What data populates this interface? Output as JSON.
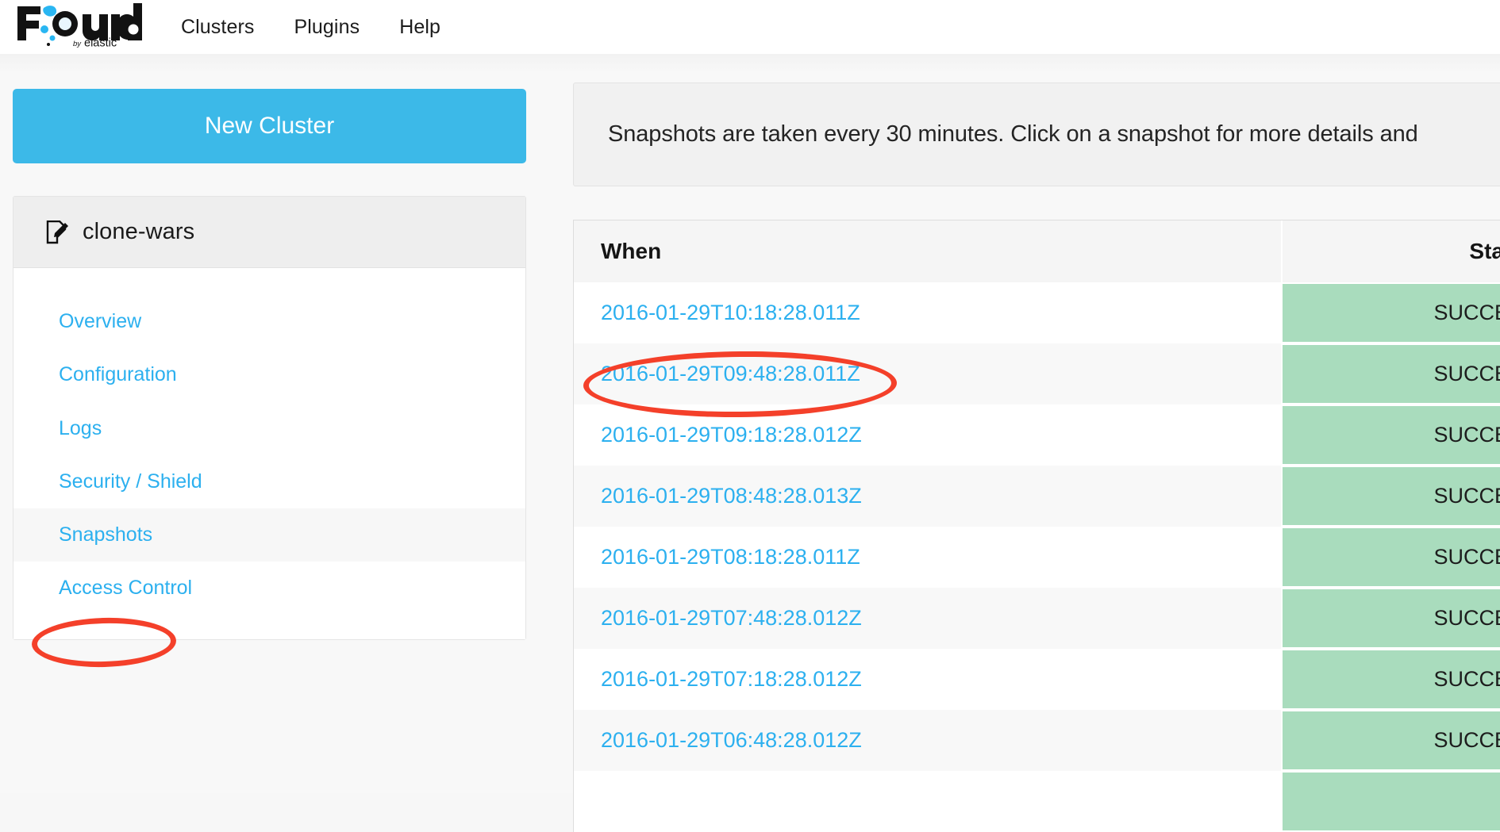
{
  "brand": {
    "name": "Found",
    "tagline_prefix": "by",
    "tagline": "elastic",
    "accent_color": "#29b6f2",
    "logo_alt": "Found by elastic"
  },
  "topnav": {
    "links": [
      {
        "label": "Clusters"
      },
      {
        "label": "Plugins"
      },
      {
        "label": "Help"
      }
    ]
  },
  "sidebar": {
    "new_cluster_label": "New Cluster",
    "cluster_name": "clone-wars",
    "cluster_icon": "edit-document-icon",
    "items": [
      {
        "label": "Overview",
        "active": false
      },
      {
        "label": "Configuration",
        "active": false
      },
      {
        "label": "Logs",
        "active": false
      },
      {
        "label": "Security / Shield",
        "active": false
      },
      {
        "label": "Snapshots",
        "active": true
      },
      {
        "label": "Access Control",
        "active": false
      }
    ]
  },
  "main": {
    "notice": "Snapshots are taken every 30 minutes. Click on a snapshot for more details and",
    "table": {
      "columns": [
        "When",
        "Status"
      ],
      "rows": [
        {
          "when": "2016-01-29T10:18:28.011Z",
          "status": "SUCCESS"
        },
        {
          "when": "2016-01-29T09:48:28.011Z",
          "status": "SUCCESS"
        },
        {
          "when": "2016-01-29T09:18:28.012Z",
          "status": "SUCCESS"
        },
        {
          "when": "2016-01-29T08:48:28.013Z",
          "status": "SUCCESS"
        },
        {
          "when": "2016-01-29T08:18:28.011Z",
          "status": "SUCCESS"
        },
        {
          "when": "2016-01-29T07:48:28.012Z",
          "status": "SUCCESS"
        },
        {
          "when": "2016-01-29T07:18:28.012Z",
          "status": "SUCCESS"
        },
        {
          "when": "2016-01-29T06:48:28.012Z",
          "status": "SUCCESS"
        },
        {
          "when": "",
          "status": ""
        }
      ]
    }
  },
  "colors": {
    "link": "#2cb0ef",
    "button": "#3cb9e8",
    "status_success_bg": "#a9dcbd",
    "annotation": "#f4402a"
  },
  "annotations": [
    {
      "name": "snapshots-nav-highlight",
      "target": "Snapshots"
    },
    {
      "name": "snapshot-row-highlight",
      "target": "2016-01-29T09:48:28.011Z"
    }
  ]
}
